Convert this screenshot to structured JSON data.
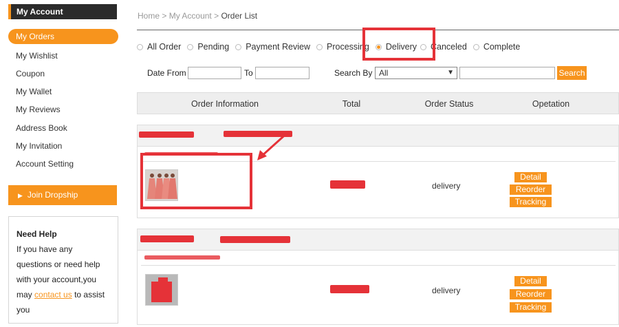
{
  "sidebar": {
    "header": "My Account",
    "active": "My Orders",
    "items": [
      "My Wishlist",
      "Coupon",
      "My Wallet",
      "My Reviews",
      "Address Book",
      "My Invitation",
      "Account Setting"
    ],
    "join": "Join Dropship",
    "help": {
      "title": "Need Help",
      "text_before": "If you have any questions or need help with your account,you may",
      "link": "contact us",
      "text_after": "to assist you"
    }
  },
  "breadcrumb": {
    "home": "Home",
    "account": "My Account",
    "current": "Order List",
    "sep": ">"
  },
  "tabs": [
    {
      "label": "All Order",
      "selected": false
    },
    {
      "label": "Pending",
      "selected": false
    },
    {
      "label": "Payment Review",
      "selected": false
    },
    {
      "label": "Processing",
      "selected": false
    },
    {
      "label": "Delivery",
      "selected": true
    },
    {
      "label": "Canceled",
      "selected": false
    },
    {
      "label": "Complete",
      "selected": false
    }
  ],
  "filter": {
    "date_from_label": "Date From",
    "to_label": "To",
    "date_from_value": "",
    "to_value": "",
    "search_by_label": "Search By",
    "search_by_value": "All",
    "keyword_value": "",
    "search_button": "Search"
  },
  "table": {
    "headers": [
      "Order Information",
      "Total",
      "Order Status",
      "Opetation"
    ]
  },
  "orders": [
    {
      "status": "delivery",
      "actions": [
        "Detail",
        "Reorder",
        "Tracking"
      ]
    },
    {
      "status": "delivery",
      "actions": [
        "Detail",
        "Reorder",
        "Tracking"
      ]
    }
  ],
  "colors": {
    "accent": "#f7941d",
    "annotation": "#e53238",
    "dark": "#2b2b2b"
  }
}
